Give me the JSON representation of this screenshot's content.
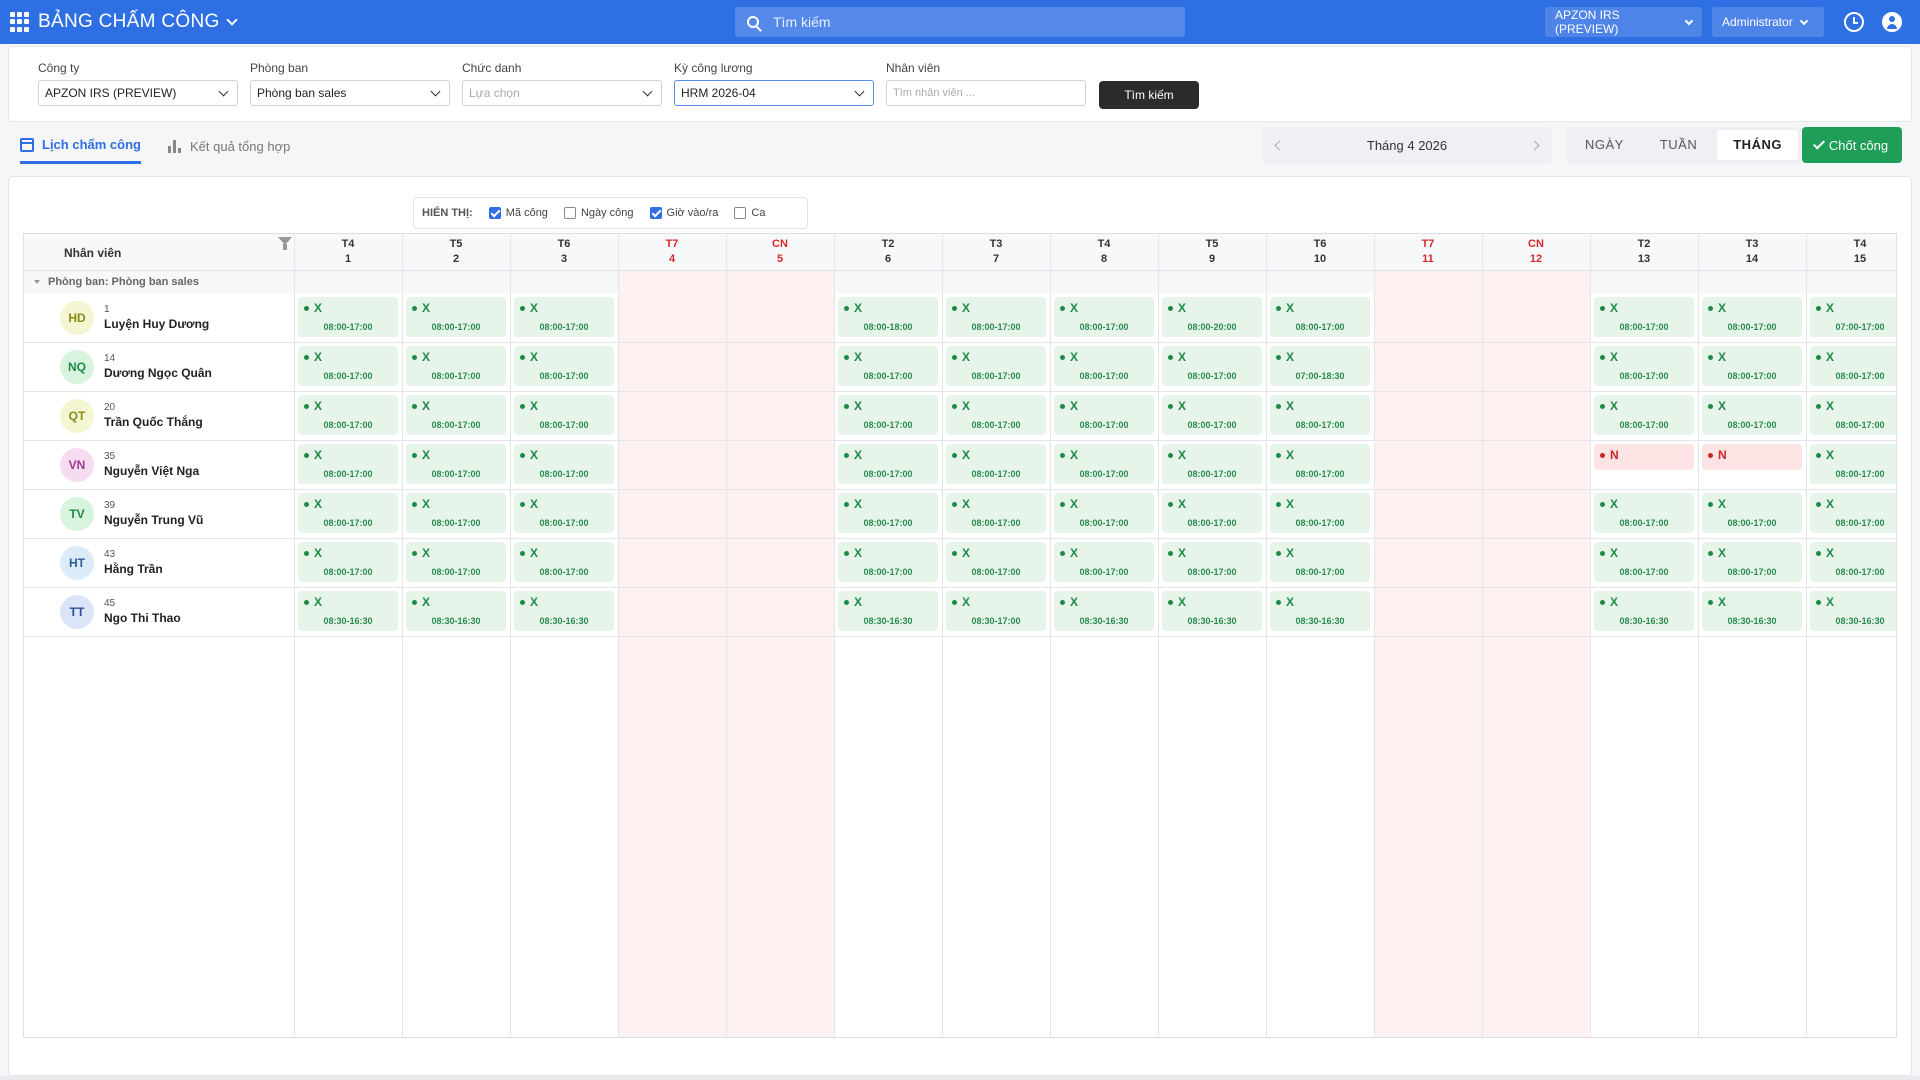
{
  "topbar": {
    "title": "BẢNG CHẤM CÔNG",
    "search_placeholder": "Tìm kiếm",
    "company_switch": "APZON IRS (PREVIEW)",
    "user_menu": "Administrator"
  },
  "filters": {
    "company": {
      "label": "Công ty",
      "value": "APZON IRS (PREVIEW)"
    },
    "department": {
      "label": "Phòng ban",
      "value": "Phòng ban sales"
    },
    "position": {
      "label": "Chức danh",
      "placeholder": "Lựa chọn"
    },
    "period": {
      "label": "Kỳ công lương",
      "value": "HRM 2026-04"
    },
    "employee": {
      "label": "Nhân viên",
      "placeholder": "Tìm nhân viên ..."
    },
    "search_button": "Tìm kiếm"
  },
  "tabs": {
    "schedule": "Lịch chấm công",
    "summary": "Kết quả tổng hợp"
  },
  "period_nav": {
    "label": "Tháng 4 2026"
  },
  "view_modes": [
    "NGÀY",
    "TUẦN",
    "THÁNG"
  ],
  "active_view": "THÁNG",
  "close_button": "Chốt công",
  "display_options": {
    "label": "HIỂN THỊ:",
    "items": [
      {
        "label": "Mã công",
        "checked": true
      },
      {
        "label": "Ngày công",
        "checked": false
      },
      {
        "label": "Giờ vào/ra",
        "checked": true
      },
      {
        "label": "Ca",
        "checked": false
      }
    ]
  },
  "grid": {
    "employee_header": "Nhân viên",
    "group_label": "Phòng ban: Phòng ban sales",
    "days": [
      {
        "dow": "T4",
        "day": "1",
        "weekend": false
      },
      {
        "dow": "T5",
        "day": "2",
        "weekend": false
      },
      {
        "dow": "T6",
        "day": "3",
        "weekend": false
      },
      {
        "dow": "T7",
        "day": "4",
        "weekend": true
      },
      {
        "dow": "CN",
        "day": "5",
        "weekend": true
      },
      {
        "dow": "T2",
        "day": "6",
        "weekend": false
      },
      {
        "dow": "T3",
        "day": "7",
        "weekend": false
      },
      {
        "dow": "T4",
        "day": "8",
        "weekend": false
      },
      {
        "dow": "T5",
        "day": "9",
        "weekend": false
      },
      {
        "dow": "T6",
        "day": "10",
        "weekend": false
      },
      {
        "dow": "T7",
        "day": "11",
        "weekend": true
      },
      {
        "dow": "CN",
        "day": "12",
        "weekend": true
      },
      {
        "dow": "T2",
        "day": "13",
        "weekend": false
      },
      {
        "dow": "T3",
        "day": "14",
        "weekend": false
      },
      {
        "dow": "T4",
        "day": "15",
        "weekend": false
      }
    ],
    "employees": [
      {
        "initials": "HD",
        "id": "1",
        "name": "Luyện Huy Dương",
        "avatar_bg": "#f3f6d0",
        "avatar_fg": "#8a8a1a",
        "cells": [
          [
            "X",
            "08:00-17:00"
          ],
          [
            "X",
            "08:00-17:00"
          ],
          [
            "X",
            "08:00-17:00"
          ],
          null,
          null,
          [
            "X",
            "08:00-18:00"
          ],
          [
            "X",
            "08:00-17:00"
          ],
          [
            "X",
            "08:00-17:00"
          ],
          [
            "X",
            "08:00-20:00"
          ],
          [
            "X",
            "08:00-17:00"
          ],
          null,
          null,
          [
            "X",
            "08:00-17:00"
          ],
          [
            "X",
            "08:00-17:00"
          ],
          [
            "X",
            "07:00-17:00"
          ]
        ]
      },
      {
        "initials": "NQ",
        "id": "14",
        "name": "Dương Ngọc Quân",
        "avatar_bg": "#d8f3de",
        "avatar_fg": "#1e8a46",
        "cells": [
          [
            "X",
            "08:00-17:00"
          ],
          [
            "X",
            "08:00-17:00"
          ],
          [
            "X",
            "08:00-17:00"
          ],
          null,
          null,
          [
            "X",
            "08:00-17:00"
          ],
          [
            "X",
            "08:00-17:00"
          ],
          [
            "X",
            "08:00-17:00"
          ],
          [
            "X",
            "08:00-17:00"
          ],
          [
            "X",
            "07:00-18:30"
          ],
          null,
          null,
          [
            "X",
            "08:00-17:00"
          ],
          [
            "X",
            "08:00-17:00"
          ],
          [
            "X",
            "08:00-17:00"
          ]
        ]
      },
      {
        "initials": "QT",
        "id": "20",
        "name": "Trần Quốc Thắng",
        "avatar_bg": "#f3f6d0",
        "avatar_fg": "#8a8a1a",
        "cells": [
          [
            "X",
            "08:00-17:00"
          ],
          [
            "X",
            "08:00-17:00"
          ],
          [
            "X",
            "08:00-17:00"
          ],
          null,
          null,
          [
            "X",
            "08:00-17:00"
          ],
          [
            "X",
            "08:00-17:00"
          ],
          [
            "X",
            "08:00-17:00"
          ],
          [
            "X",
            "08:00-17:00"
          ],
          [
            "X",
            "08:00-17:00"
          ],
          null,
          null,
          [
            "X",
            "08:00-17:00"
          ],
          [
            "X",
            "08:00-17:00"
          ],
          [
            "X",
            "08:00-17:00"
          ]
        ]
      },
      {
        "initials": "VN",
        "id": "35",
        "name": "Nguyễn Việt Nga",
        "avatar_bg": "#f6dcf0",
        "avatar_fg": "#a23a92",
        "cells": [
          [
            "X",
            "08:00-17:00"
          ],
          [
            "X",
            "08:00-17:00"
          ],
          [
            "X",
            "08:00-17:00"
          ],
          null,
          null,
          [
            "X",
            "08:00-17:00"
          ],
          [
            "X",
            "08:00-17:00"
          ],
          [
            "X",
            "08:00-17:00"
          ],
          [
            "X",
            "08:00-17:00"
          ],
          [
            "X",
            "08:00-17:00"
          ],
          null,
          null,
          [
            "N",
            ""
          ],
          [
            "N",
            ""
          ],
          [
            "X",
            "08:00-17:00"
          ]
        ]
      },
      {
        "initials": "TV",
        "id": "39",
        "name": "Nguyễn Trung Vũ",
        "avatar_bg": "#d8f3de",
        "avatar_fg": "#1e8a46",
        "cells": [
          [
            "X",
            "08:00-17:00"
          ],
          [
            "X",
            "08:00-17:00"
          ],
          [
            "X",
            "08:00-17:00"
          ],
          null,
          null,
          [
            "X",
            "08:00-17:00"
          ],
          [
            "X",
            "08:00-17:00"
          ],
          [
            "X",
            "08:00-17:00"
          ],
          [
            "X",
            "08:00-17:00"
          ],
          [
            "X",
            "08:00-17:00"
          ],
          null,
          null,
          [
            "X",
            "08:00-17:00"
          ],
          [
            "X",
            "08:00-17:00"
          ],
          [
            "X",
            "08:00-17:00"
          ]
        ]
      },
      {
        "initials": "HT",
        "id": "43",
        "name": "Hằng Trần",
        "avatar_bg": "#dcebf8",
        "avatar_fg": "#2a5d94",
        "cells": [
          [
            "X",
            "08:00-17:00"
          ],
          [
            "X",
            "08:00-17:00"
          ],
          [
            "X",
            "08:00-17:00"
          ],
          null,
          null,
          [
            "X",
            "08:00-17:00"
          ],
          [
            "X",
            "08:00-17:00"
          ],
          [
            "X",
            "08:00-17:00"
          ],
          [
            "X",
            "08:00-17:00"
          ],
          [
            "X",
            "08:00-17:00"
          ],
          null,
          null,
          [
            "X",
            "08:00-17:00"
          ],
          [
            "X",
            "08:00-17:00"
          ],
          [
            "X",
            "08:00-17:00"
          ]
        ]
      },
      {
        "initials": "TT",
        "id": "45",
        "name": "Ngo Thi Thao",
        "avatar_bg": "#dce4f8",
        "avatar_fg": "#2a4d94",
        "cells": [
          [
            "X",
            "08:30-16:30"
          ],
          [
            "X",
            "08:30-16:30"
          ],
          [
            "X",
            "08:30-16:30"
          ],
          null,
          null,
          [
            "X",
            "08:30-16:30"
          ],
          [
            "X",
            "08:30-17:00"
          ],
          [
            "X",
            "08:30-16:30"
          ],
          [
            "X",
            "08:30-16:30"
          ],
          [
            "X",
            "08:30-16:30"
          ],
          null,
          null,
          [
            "X",
            "08:30-16:30"
          ],
          [
            "X",
            "08:30-16:30"
          ],
          [
            "X",
            "08:30-16:30"
          ]
        ]
      }
    ]
  }
}
